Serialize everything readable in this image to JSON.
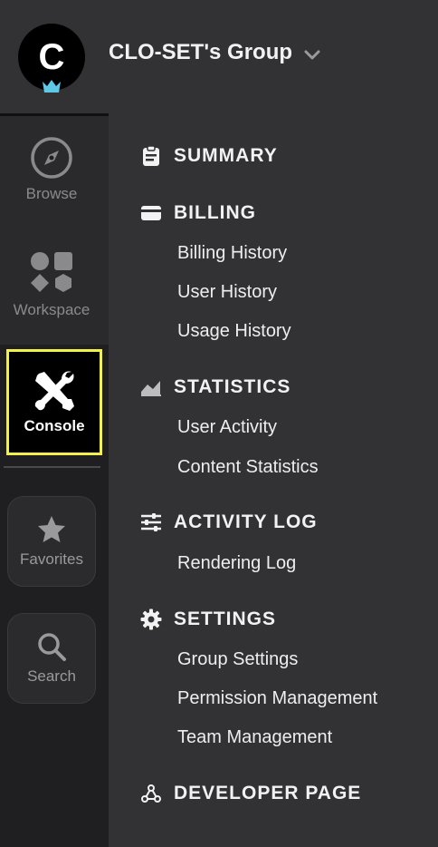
{
  "header": {
    "avatar_letter": "C",
    "group_name": "CLO-SET's Group"
  },
  "rail": {
    "browse": "Browse",
    "workspace": "Workspace",
    "console": "Console",
    "favorites": "Favorites",
    "search": "Search"
  },
  "nav": {
    "summary": "SUMMARY",
    "billing": {
      "title": "BILLING",
      "items": [
        "Billing History",
        "User History",
        "Usage History"
      ]
    },
    "statistics": {
      "title": "STATISTICS",
      "items": [
        "User Activity",
        "Content Statistics"
      ]
    },
    "activity_log": {
      "title": "ACTIVITY LOG",
      "items": [
        "Rendering Log"
      ]
    },
    "settings": {
      "title": "SETTINGS",
      "items": [
        "Group Settings",
        "Permission Management",
        "Team Management"
      ]
    },
    "developer": "DEVELOPER PAGE"
  },
  "colors": {
    "highlight": "#f2f04a",
    "crown": "#5ec8e6"
  }
}
